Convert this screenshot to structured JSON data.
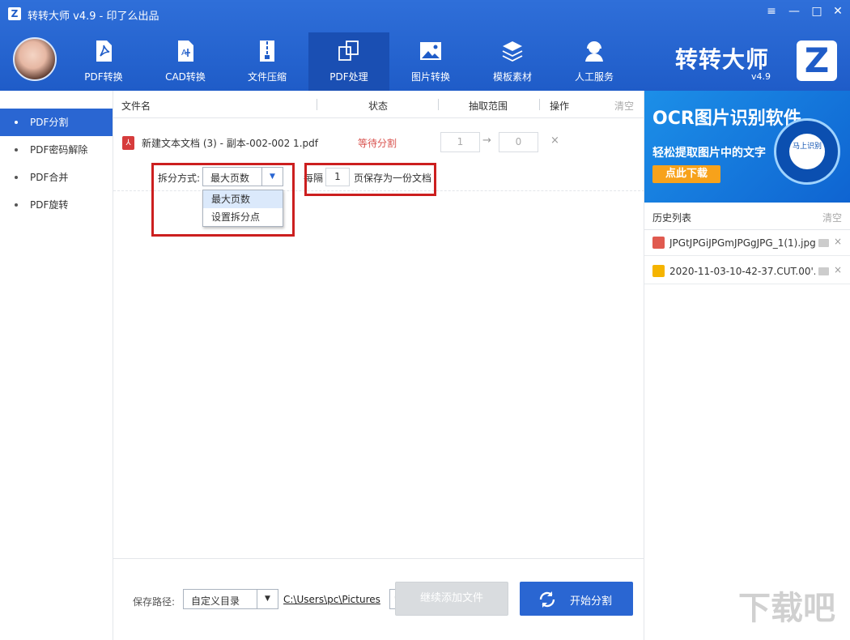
{
  "window": {
    "logo": "Z",
    "title": "转转大师 v4.9 - 印了么出品",
    "controls": [
      "≡",
      "—",
      "□",
      "✕"
    ]
  },
  "nav": {
    "items": [
      {
        "label": "PDF转换",
        "icon": "pdf-icon"
      },
      {
        "label": "CAD转换",
        "icon": "cad-icon"
      },
      {
        "label": "文件压缩",
        "icon": "zip-icon"
      },
      {
        "label": "PDF处理",
        "icon": "pdf-process-icon",
        "active": true
      },
      {
        "label": "图片转换",
        "icon": "image-icon"
      },
      {
        "label": "模板素材",
        "icon": "layers-icon"
      },
      {
        "label": "人工服务",
        "icon": "support-icon"
      }
    ]
  },
  "brand": {
    "text": "转转大师",
    "version": "v4.9",
    "logo": "Z"
  },
  "sidebar": {
    "items": [
      {
        "label": "PDF分割",
        "active": true
      },
      {
        "label": "PDF密码解除"
      },
      {
        "label": "PDF合并"
      },
      {
        "label": "PDF旋转"
      }
    ]
  },
  "table": {
    "headers": {
      "filename": "文件名",
      "status": "状态",
      "range": "抽取范围",
      "action": "操作",
      "clear": "清空"
    },
    "row": {
      "filename": "新建文本文档 (3) - 副本-002-002 1.pdf",
      "status": "等待分割",
      "range_from": "1",
      "range_arrow": "→",
      "range_to": "0",
      "delete": "×"
    }
  },
  "split": {
    "mode_label": "拆分方式:",
    "mode_value": "最大页数",
    "options": [
      "最大页数",
      "设置拆分点"
    ],
    "every_label": "每隔",
    "pages_value": "1",
    "save_each_label": "页保存为一份文档"
  },
  "footer": {
    "save_path_label": "保存路径:",
    "path_mode": "自定义目录",
    "path": "C:\\Users\\pc\\Pictures",
    "more": "···",
    "add_files_button": "继续添加文件",
    "start_button": "开始分割"
  },
  "banner": {
    "title": "OCR图片识别软件",
    "subtitle": "轻松提取图片中的文字",
    "button": "点此下载",
    "circle_text": "马上识别"
  },
  "history": {
    "title": "历史列表",
    "clear": "清空",
    "items": [
      {
        "name": "JPGtJPGiJPGmJPGgJPG_1(1).jpg",
        "icon": "image-file-icon",
        "color": "#e05a4f"
      },
      {
        "name": "2020-11-03-10-42-37.CUT.00'...",
        "icon": "video-file-icon",
        "color": "#f5b400"
      }
    ]
  },
  "watermark": {
    "text": "下载吧"
  },
  "colors": {
    "primary": "#2a66d2",
    "titlebar": "#1f5cc8",
    "status": "#d9534f",
    "highlight": "#cc1f1f"
  }
}
